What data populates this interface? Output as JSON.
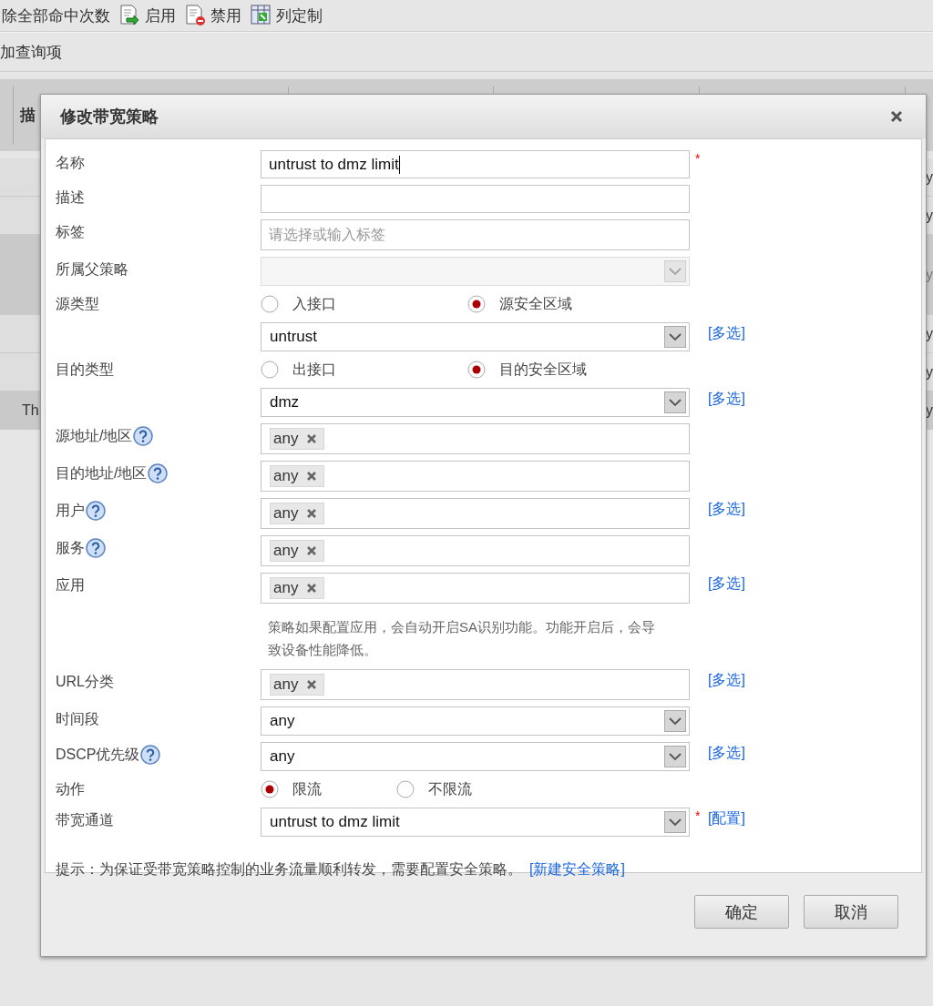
{
  "toolbar": {
    "buttons": [
      {
        "label": "除全部命中次数"
      },
      {
        "label": "启用"
      },
      {
        "label": "禁用"
      },
      {
        "label": "列定制"
      }
    ]
  },
  "query_bar": {
    "label": "加查询项"
  },
  "table": {
    "columns": [
      "描"
    ],
    "rows": [
      {
        "last_column": "y",
        "highlighted": false,
        "dimmed": false
      },
      {
        "last_column": "y",
        "highlighted": false,
        "dimmed": false
      },
      {
        "last_column": "y",
        "highlighted": true,
        "dimmed": true
      },
      {
        "last_column": "y",
        "highlighted": false,
        "dimmed": false
      },
      {
        "last_column": "y",
        "highlighted": false,
        "dimmed": false
      },
      {
        "column_1": "Th",
        "last_column": "y",
        "highlighted": true,
        "dimmed": false
      }
    ]
  },
  "dialog": {
    "title": "修改带宽策略",
    "fields": [
      {
        "kind": "text",
        "label": "名称",
        "value": "untrust to dmz limit",
        "focused": true,
        "required_mark": "*",
        "help": false
      },
      {
        "kind": "text",
        "label": "描述",
        "focused": false,
        "required": false,
        "help": false
      },
      {
        "kind": "text",
        "label": "标签",
        "placeholder": "请选择或输入标签",
        "focused": false,
        "required": false,
        "help": false
      },
      {
        "kind": "select",
        "label": "所属父策略",
        "disabled": true,
        "required": false,
        "help": false
      },
      {
        "kind": "radio",
        "label": "源类型",
        "help": false,
        "options": [
          {
            "label": "入接口",
            "selected": false
          },
          {
            "label": "源安全区域",
            "selected": true
          }
        ]
      },
      {
        "kind": "select",
        "value": "untrust",
        "disabled": false,
        "required": false,
        "help": false,
        "link": "[多选]"
      },
      {
        "kind": "radio",
        "label": "目的类型",
        "help": false,
        "options": [
          {
            "label": "出接口",
            "selected": false
          },
          {
            "label": "目的安全区域",
            "selected": true
          }
        ]
      },
      {
        "kind": "select",
        "value": "dmz",
        "disabled": false,
        "required": false,
        "help": false,
        "link": "[多选]"
      },
      {
        "kind": "tags",
        "label": "源地址/地区",
        "help": true,
        "required": false,
        "tags": [
          "any"
        ]
      },
      {
        "kind": "tags",
        "label": "目的地址/地区",
        "help": true,
        "required": false,
        "tags": [
          "any"
        ]
      },
      {
        "kind": "tags",
        "label": "用户",
        "help": true,
        "required": false,
        "tags": [
          "any"
        ],
        "link": "[多选]"
      },
      {
        "kind": "tags",
        "label": "服务",
        "help": true,
        "required": false,
        "tags": [
          "any"
        ]
      },
      {
        "kind": "tags",
        "label": "应用",
        "help": false,
        "required": false,
        "tags": [
          "any"
        ],
        "link": "[多选]"
      },
      {
        "kind": "note",
        "text": "策略如果配置应用，会自动开启SA识别功能。功能开启后，会导致设备性能降低。"
      },
      {
        "kind": "tags",
        "label": "URL分类",
        "help": false,
        "required": false,
        "tags": [
          "any"
        ],
        "link": "[多选]"
      },
      {
        "kind": "select",
        "label": "时间段",
        "value": "any",
        "disabled": false,
        "required": false,
        "help": false
      },
      {
        "kind": "select",
        "label": "DSCP优先级",
        "value": "any",
        "disabled": false,
        "required": false,
        "help": true,
        "link": "[多选]"
      },
      {
        "kind": "radio",
        "label": "动作",
        "help": false,
        "options": [
          {
            "label": "限流",
            "selected": true
          },
          {
            "label": "不限流",
            "selected": false
          }
        ]
      },
      {
        "kind": "select",
        "label": "带宽通道",
        "value": "untrust to dmz limit",
        "disabled": false,
        "required_mark": "*",
        "help": false,
        "link": "[配置]"
      }
    ],
    "hint": {
      "text": "提示：为保证受带宽策略控制的业务流量顺利转发，需要配置安全策略。",
      "link": "[新建安全策略]"
    },
    "buttons": [
      {
        "label": "确定"
      },
      {
        "label": "取消"
      }
    ]
  }
}
